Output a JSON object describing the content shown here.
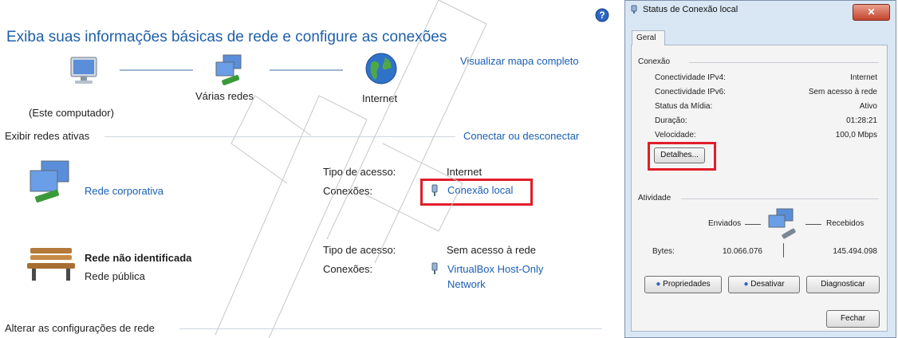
{
  "page": {
    "title": "Exiba suas informações básicas de rede e configure as conexões",
    "help_icon": "help-icon",
    "map": {
      "computer_label": "(Este computador)",
      "networks_label": "Várias redes",
      "internet_label": "Internet",
      "full_map_link": "Visualizar mapa completo"
    },
    "active_networks": {
      "header": "Exibir redes ativas",
      "connect_link": "Conectar ou desconectar",
      "networks": [
        {
          "name": "Rede corporativa",
          "subtitle": "",
          "access_label": "Tipo de acesso:",
          "access_value": "Internet",
          "connections_label": "Conexões:",
          "connection_value": "Conexão local",
          "icon": "network-computers-icon"
        },
        {
          "name": "Rede não identificada",
          "subtitle": "Rede pública",
          "access_label": "Tipo de acesso:",
          "access_value": "Sem acesso à rede",
          "connections_label": "Conexões:",
          "connection_value_line1": "VirtualBox Host-Only",
          "connection_value_line2": "Network",
          "icon": "park-bench-icon"
        }
      ]
    },
    "change_settings_header": "Alterar as configurações de rede"
  },
  "dialog": {
    "title": "Status de Conexão local",
    "tab": "Geral",
    "connection": {
      "header": "Conexão",
      "rows": [
        {
          "label": "Conectividade IPv4:",
          "value": "Internet"
        },
        {
          "label": "Conectividade IPv6:",
          "value": "Sem acesso à rede"
        },
        {
          "label": "Status da Mídia:",
          "value": "Ativo"
        },
        {
          "label": "Duração:",
          "value": "01:28:21"
        },
        {
          "label": "Velocidade:",
          "value": "100,0 Mbps"
        }
      ],
      "details_button": "Detalhes..."
    },
    "activity": {
      "header": "Atividade",
      "sent_label": "Enviados",
      "received_label": "Recebidos",
      "bytes_label": "Bytes:",
      "bytes_sent": "10.066.076",
      "bytes_received": "145.494.098"
    },
    "buttons": {
      "properties": "Propriedades",
      "disable": "Desativar",
      "diagnose": "Diagnosticar",
      "close": "Fechar"
    }
  },
  "colors": {
    "accent_link": "#1a5fb4",
    "highlight_red": "#e11d2a",
    "title_blue": "#1f5fa8"
  }
}
